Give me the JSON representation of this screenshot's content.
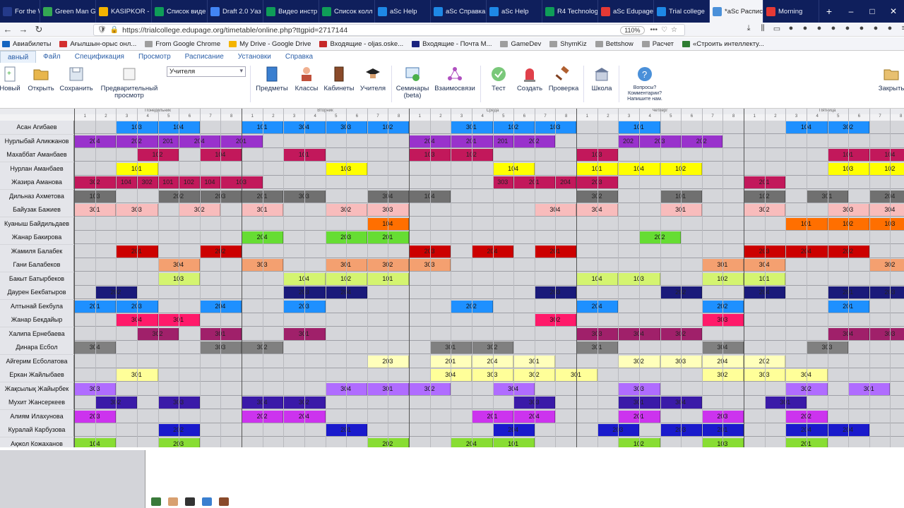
{
  "browser": {
    "tabs": [
      {
        "label": "For the Week",
        "color": "#243a8a"
      },
      {
        "label": "Green Man G",
        "color": "#34a853"
      },
      {
        "label": "KASIPKOR - G",
        "color": "#f4b400"
      },
      {
        "label": "Список виде",
        "color": "#0f9d58"
      },
      {
        "label": "Draft 2.0 Уаз",
        "color": "#4285f4"
      },
      {
        "label": "Видео инстр",
        "color": "#0f9d58"
      },
      {
        "label": "Список колл",
        "color": "#0f9d58"
      },
      {
        "label": "aSc Help",
        "color": "#1e88e5"
      },
      {
        "label": "aSc Справка",
        "color": "#1e88e5"
      },
      {
        "label": "aSc Help",
        "color": "#1e88e5"
      },
      {
        "label": "R4 Technolog",
        "color": "#0f9d58"
      },
      {
        "label": "aSc Edupage",
        "color": "#e53935"
      },
      {
        "label": "Trial college",
        "color": "#1e88e5"
      },
      {
        "label": "*aSc Распис",
        "color": "#4a90d9",
        "active": true
      },
      {
        "label": "Morning",
        "color": "#e53935"
      }
    ],
    "new_tab": "+",
    "window_controls": [
      "–",
      "□",
      "✕"
    ],
    "url": "https://trialcollege.edupage.org/timetable/online.php?ttgpid=2717144",
    "zoom": "110%",
    "bookmarks": [
      {
        "label": "Авиабилеты",
        "color": "#1565c0"
      },
      {
        "label": "Ағылшын-орыс онл...",
        "color": "#d32f2f"
      },
      {
        "label": "From Google Chrome",
        "color": "#9e9e9e"
      },
      {
        "label": "My Drive - Google Drive",
        "color": "#f4b400"
      },
      {
        "label": "Входящие - oljas.oske...",
        "color": "#c62828"
      },
      {
        "label": "Входящие - Почта М...",
        "color": "#1a237e"
      },
      {
        "label": "GameDev",
        "color": "#9e9e9e"
      },
      {
        "label": "ShymKiz",
        "color": "#9e9e9e"
      },
      {
        "label": "Bettshow",
        "color": "#9e9e9e"
      },
      {
        "label": "Расчет",
        "color": "#9e9e9e"
      },
      {
        "label": "«Строить интеллекту...",
        "color": "#2e7d32"
      }
    ]
  },
  "app": {
    "menus": [
      "авный",
      "Файл",
      "Спецификация",
      "Просмотр",
      "Расписание",
      "Установки",
      "Справка"
    ],
    "ribbon": {
      "new": "Новый",
      "open": "Открыть",
      "save": "Сохранить",
      "preview": "Предварительный просмотр",
      "view_select": "Учителя",
      "subjects": "Предметы",
      "classes": "Классы",
      "rooms": "Кабинеты",
      "teachers": "Учителя",
      "seminars": "Семинары (beta)",
      "relations": "Взаимосвязи",
      "test": "Тест",
      "create": "Создать",
      "check": "Проверка",
      "school": "Школа",
      "questions": "Вопросы? Комментарии? Напишите нам.",
      "close": "Закрыть"
    },
    "days": [
      "Понедельник",
      "Вторник",
      "Среда",
      "Четверг",
      "Пятница"
    ],
    "periods": [
      "1",
      "2",
      "3",
      "4",
      "5",
      "6",
      "7",
      "8"
    ],
    "timetable": [
      {
        "teacher": "Асан Агибаев",
        "color": "#1e90ff",
        "lessons": [
          [
            2,
            "103"
          ],
          [
            4,
            "104"
          ],
          [
            8,
            "101"
          ],
          [
            10,
            "304"
          ],
          [
            12,
            "303"
          ],
          [
            14,
            "102"
          ],
          [
            18,
            "301"
          ],
          [
            20,
            "102"
          ],
          [
            22,
            "103"
          ],
          [
            26,
            "101"
          ],
          [
            34,
            "104"
          ],
          [
            36,
            "302"
          ]
        ]
      },
      {
        "teacher": "Нурлыбай Аликжанов",
        "color": "#9932cc",
        "lessons": [
          [
            0,
            "204"
          ],
          [
            2,
            "202"
          ],
          [
            4,
            "201"
          ],
          [
            5,
            "204"
          ],
          [
            7,
            "201"
          ],
          [
            16,
            "204"
          ],
          [
            18,
            "201"
          ],
          [
            20,
            "201"
          ],
          [
            21,
            "202"
          ],
          [
            26,
            "202"
          ],
          [
            27,
            "203"
          ],
          [
            29,
            "202"
          ]
        ]
      },
      {
        "teacher": "Махаббат Аманбаев",
        "color": "#c2185b",
        "lessons": [
          [
            3,
            "102"
          ],
          [
            6,
            "104"
          ],
          [
            10,
            "101"
          ],
          [
            16,
            "103"
          ],
          [
            18,
            "102"
          ],
          [
            24,
            "103"
          ],
          [
            36,
            "101"
          ],
          [
            38,
            "104"
          ]
        ]
      },
      {
        "teacher": "Нурлан Аманбаев",
        "color": "#ffff00",
        "lessons": [
          [
            2,
            "101"
          ],
          [
            12,
            "103"
          ],
          [
            20,
            "104"
          ],
          [
            24,
            "101"
          ],
          [
            26,
            "104"
          ],
          [
            28,
            "102"
          ],
          [
            36,
            "103"
          ],
          [
            38,
            "102"
          ]
        ]
      },
      {
        "teacher": "Жазира Аманова",
        "color": "#c2185b",
        "lessons": [
          [
            0,
            "302"
          ],
          [
            2,
            "104"
          ],
          [
            3,
            "302"
          ],
          [
            4,
            "101"
          ],
          [
            5,
            "102"
          ],
          [
            6,
            "104"
          ],
          [
            7,
            "103"
          ],
          [
            20,
            "303"
          ],
          [
            21,
            "201"
          ],
          [
            23,
            "204"
          ],
          [
            24,
            "203"
          ],
          [
            32,
            "201"
          ]
        ]
      },
      {
        "teacher": "Дильназ Ахметова",
        "color": "#707070",
        "lessons": [
          [
            0,
            "103"
          ],
          [
            4,
            "202"
          ],
          [
            6,
            "203"
          ],
          [
            8,
            "201"
          ],
          [
            10,
            "303"
          ],
          [
            14,
            "304"
          ],
          [
            16,
            "104"
          ],
          [
            24,
            "302"
          ],
          [
            28,
            "101"
          ],
          [
            32,
            "102"
          ],
          [
            35,
            "301"
          ],
          [
            38,
            "204"
          ]
        ]
      },
      {
        "teacher": "Байузак Бажиев",
        "color": "#f8bcbc",
        "lessons": [
          [
            0,
            "301"
          ],
          [
            2,
            "303"
          ],
          [
            5,
            "302"
          ],
          [
            8,
            "301"
          ],
          [
            12,
            "302"
          ],
          [
            14,
            "303"
          ],
          [
            22,
            "304"
          ],
          [
            24,
            "304"
          ],
          [
            28,
            "301"
          ],
          [
            32,
            "302"
          ],
          [
            36,
            "303"
          ],
          [
            38,
            "304"
          ]
        ]
      },
      {
        "teacher": "Куаныш Байдильдаев",
        "color": "#ff6f00",
        "lessons": [
          [
            14,
            "104"
          ],
          [
            34,
            "101"
          ],
          [
            36,
            "102"
          ],
          [
            38,
            "103"
          ]
        ]
      },
      {
        "teacher": "Жанар Бакирова",
        "color": "#66dd33",
        "lessons": [
          [
            8,
            "204"
          ],
          [
            12,
            "203"
          ],
          [
            14,
            "201"
          ],
          [
            27,
            "202"
          ]
        ]
      },
      {
        "teacher": "Жамиля Балабек",
        "color": "#cc0000",
        "lessons": [
          [
            2,
            "201"
          ],
          [
            6,
            "202"
          ],
          [
            16,
            "203"
          ],
          [
            19,
            "204"
          ],
          [
            22,
            "201"
          ],
          [
            32,
            "203"
          ],
          [
            34,
            "204"
          ],
          [
            36,
            "202"
          ]
        ]
      },
      {
        "teacher": "Гани Балабеков",
        "color": "#f4a070",
        "lessons": [
          [
            4,
            "304"
          ],
          [
            8,
            "303"
          ],
          [
            12,
            "301"
          ],
          [
            14,
            "302"
          ],
          [
            16,
            "303"
          ],
          [
            30,
            "301"
          ],
          [
            32,
            "304"
          ],
          [
            38,
            "302"
          ]
        ]
      },
      {
        "teacher": "Бакыт Батырбеков",
        "color": "#d4f470",
        "lessons": [
          [
            4,
            "103"
          ],
          [
            10,
            "104"
          ],
          [
            12,
            "102"
          ],
          [
            14,
            "101"
          ],
          [
            24,
            "104"
          ],
          [
            26,
            "103"
          ],
          [
            30,
            "102"
          ],
          [
            32,
            "101"
          ]
        ]
      },
      {
        "teacher": "Даурен Бекбатыров",
        "color": "#1a1a7a",
        "lessons": [
          [
            1,
            "202"
          ],
          [
            10,
            "203"
          ],
          [
            12,
            "204"
          ],
          [
            22,
            "203"
          ],
          [
            28,
            "202"
          ],
          [
            32,
            "204"
          ],
          [
            36,
            "201"
          ],
          [
            38,
            "203"
          ]
        ]
      },
      {
        "teacher": "Алтынай Бекбула",
        "color": "#1e90ff",
        "lessons": [
          [
            0,
            "201"
          ],
          [
            2,
            "203"
          ],
          [
            6,
            "204"
          ],
          [
            10,
            "203"
          ],
          [
            18,
            "202"
          ],
          [
            24,
            "204"
          ],
          [
            30,
            "202"
          ],
          [
            36,
            "201"
          ]
        ]
      },
      {
        "teacher": "Жанар Бекдайыр",
        "color": "#ff1a6a",
        "lessons": [
          [
            2,
            "304"
          ],
          [
            4,
            "301"
          ],
          [
            22,
            "302"
          ],
          [
            30,
            "303"
          ]
        ]
      },
      {
        "teacher": "Халипа Ернебаева",
        "color": "#a0206a",
        "lessons": [
          [
            3,
            "302"
          ],
          [
            6,
            "301"
          ],
          [
            10,
            "301"
          ],
          [
            24,
            "303"
          ],
          [
            26,
            "304"
          ],
          [
            28,
            "302"
          ],
          [
            36,
            "304"
          ],
          [
            38,
            "303"
          ]
        ]
      },
      {
        "teacher": "Динара Есбол",
        "color": "#808080",
        "lessons": [
          [
            0,
            "304"
          ],
          [
            6,
            "303"
          ],
          [
            8,
            "302"
          ],
          [
            17,
            "301"
          ],
          [
            19,
            "302"
          ],
          [
            24,
            "301"
          ],
          [
            30,
            "304"
          ],
          [
            35,
            "303"
          ]
        ]
      },
      {
        "teacher": "Айгерим Есболатова",
        "color": "#ffffbb",
        "lessons": [
          [
            14,
            "203"
          ],
          [
            17,
            "201"
          ],
          [
            19,
            "204"
          ],
          [
            21,
            "301"
          ],
          [
            26,
            "302"
          ],
          [
            28,
            "303"
          ],
          [
            30,
            "204"
          ],
          [
            32,
            "202"
          ]
        ]
      },
      {
        "teacher": "Еркан Жайлыбаев",
        "color": "#ffff99",
        "lessons": [
          [
            2,
            "301"
          ],
          [
            17,
            "304"
          ],
          [
            19,
            "303"
          ],
          [
            21,
            "302"
          ],
          [
            23,
            "301"
          ],
          [
            30,
            "302"
          ],
          [
            32,
            "303"
          ],
          [
            34,
            "304"
          ]
        ]
      },
      {
        "teacher": "Жақсылық Жайырбек",
        "color": "#b06cff",
        "lessons": [
          [
            0,
            "303"
          ],
          [
            12,
            "304"
          ],
          [
            14,
            "301"
          ],
          [
            16,
            "302"
          ],
          [
            20,
            "304"
          ],
          [
            26,
            "303"
          ],
          [
            34,
            "302"
          ],
          [
            37,
            "301"
          ]
        ]
      },
      {
        "teacher": "Мухит Жансеркеев",
        "color": "#3a1aa8",
        "lessons": [
          [
            1,
            "302"
          ],
          [
            4,
            "303"
          ],
          [
            8,
            "304"
          ],
          [
            10,
            "302"
          ],
          [
            21,
            "303"
          ],
          [
            26,
            "301"
          ],
          [
            28,
            "304"
          ],
          [
            33,
            "301"
          ]
        ]
      },
      {
        "teacher": "Алиям Илахунова",
        "color": "#cc33ee",
        "lessons": [
          [
            0,
            "203"
          ],
          [
            8,
            "202"
          ],
          [
            10,
            "204"
          ],
          [
            19,
            "201"
          ],
          [
            21,
            "204"
          ],
          [
            26,
            "201"
          ],
          [
            30,
            "203"
          ],
          [
            34,
            "202"
          ]
        ]
      },
      {
        "teacher": "Куралай Карбузова",
        "color": "#1a1acc",
        "lessons": [
          [
            4,
            "202"
          ],
          [
            12,
            "201"
          ],
          [
            20,
            "204"
          ],
          [
            25,
            "203"
          ],
          [
            28,
            "203"
          ],
          [
            30,
            "201"
          ],
          [
            34,
            "204"
          ],
          [
            36,
            "204"
          ]
        ]
      },
      {
        "teacher": "Ақжол Кожаханов",
        "color": "#88dd33",
        "lessons": [
          [
            0,
            "104"
          ],
          [
            4,
            "203"
          ],
          [
            14,
            "202"
          ],
          [
            18,
            "204"
          ],
          [
            20,
            "101"
          ],
          [
            26,
            "102"
          ],
          [
            30,
            "103"
          ],
          [
            34,
            "201"
          ]
        ]
      }
    ]
  }
}
